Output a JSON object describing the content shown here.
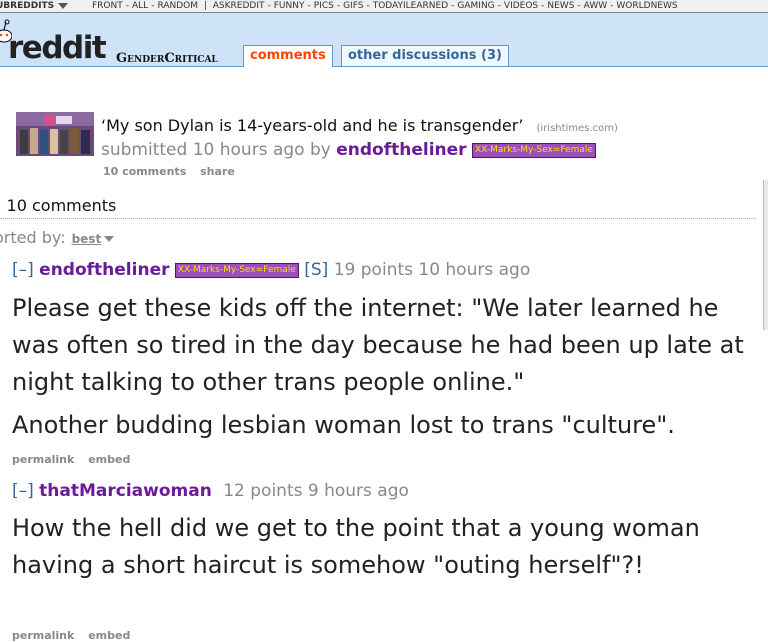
{
  "srbar": {
    "dropdown_label": "UBREDDITS",
    "items": [
      "FRONT",
      "ALL",
      "RANDOM",
      "ASKREDDIT",
      "FUNNY",
      "PICS",
      "GIFS",
      "TODAYILEARNED",
      "GAMING",
      "VIDEOS",
      "NEWS",
      "AWW",
      "WORLDNEWS"
    ]
  },
  "header": {
    "logo": "reddit",
    "subreddit": "GenderCritical",
    "tabs": [
      {
        "label": "comments",
        "active": true
      },
      {
        "label": "other discussions (3)",
        "active": false
      }
    ]
  },
  "post": {
    "title": "‘My son Dylan is 14-years-old and he is transgender’",
    "domain": "(irishtimes.com)",
    "submitted_prefix": "submitted",
    "time": "10 hours ago",
    "by": "by",
    "author": "endoftheliner",
    "flair": "XX-Marks-My-Sex=Female",
    "buttons": {
      "comments": "10 comments",
      "share": "share"
    }
  },
  "comments_area": {
    "count_label": "l 10 comments",
    "sorted_label": "orted by:",
    "sort_value": "best"
  },
  "comments": [
    {
      "collapse": "[–]",
      "author": "endoftheliner",
      "flair": "XX-Marks-My-Sex=Female",
      "submitter_tag": "[S]",
      "points": "19 points",
      "time": "10 hours ago",
      "paragraphs": [
        "Please get these kids off the internet: \"We later learned he was often so tired in the day because he had been up late at night talking to other trans people online.\"",
        "Another budding lesbian woman lost to trans \"culture\"."
      ],
      "buttons": {
        "permalink": "permalink",
        "embed": "embed"
      }
    },
    {
      "collapse": "[–]",
      "author": "thatMarciawoman",
      "points": "12 points",
      "time": "9 hours ago",
      "paragraphs": [
        "How the hell did we get to the point that a young woman having a short haircut is somehow \"outing herself\"?!"
      ],
      "buttons": {
        "permalink": "permalink",
        "embed": "embed"
      }
    }
  ],
  "colors": {
    "header_bg": "#cee3f8",
    "active_tab": "#ff4500",
    "link_blue": "#336699",
    "author_purple": "#6a1b9a",
    "flair_bg": "#9b4fb8",
    "flair_text": "#ffe000"
  }
}
